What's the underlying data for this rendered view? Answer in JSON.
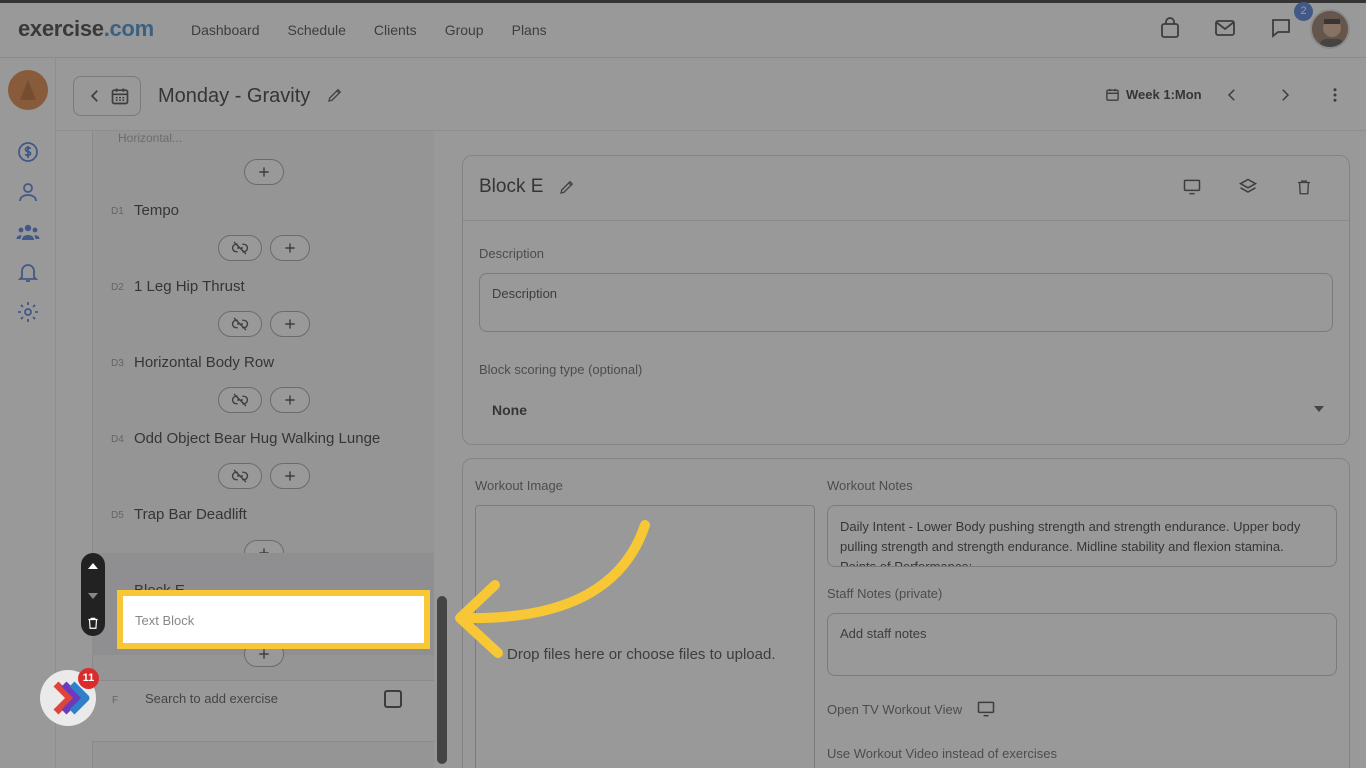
{
  "brand": {
    "name": "exercise",
    "tld": ".com"
  },
  "nav": [
    "Dashboard",
    "Schedule",
    "Clients",
    "Group",
    "Plans"
  ],
  "top_icons": {
    "bag": "shopping-bag-icon",
    "mail": "mail-icon",
    "chat": "chat-icon",
    "chat_badge": "2"
  },
  "page": {
    "title": "Monday - Gravity",
    "week_label": "Week 1:Mon"
  },
  "left_list": {
    "truncated_top": "Horizontal...",
    "exercises": [
      {
        "code": "D1",
        "name": "Tempo"
      },
      {
        "code": "D2",
        "name": "1 Leg Hip Thrust"
      },
      {
        "code": "D3",
        "name": "Horizontal Body Row"
      },
      {
        "code": "D4",
        "name": "Odd Object Bear Hug Walking Lunge"
      },
      {
        "code": "D5",
        "name": "Trap Bar Deadlift"
      }
    ],
    "block_e_label": "Block E",
    "text_block": "Text Block",
    "search_code": "F",
    "search_placeholder": "Search to add exercise"
  },
  "fab_badge": "11",
  "block_card": {
    "title": "Block E",
    "description_label": "Description",
    "description_placeholder": "Description",
    "scoring_label": "Block scoring type (optional)",
    "scoring_value": "None"
  },
  "workout": {
    "image_label": "Workout Image",
    "drop_text": "Drop files here or choose files to upload.",
    "notes_label": "Workout Notes",
    "notes_line1": "Daily Intent - Lower Body pushing strength and strength endurance. Upper body",
    "notes_line2": "pulling strength and strength endurance. Midline stability and flexion stamina.",
    "notes_line3": "Points of Performance:",
    "staff_label": "Staff Notes (private)",
    "staff_placeholder": "Add staff notes",
    "tv_label": "Open TV Workout View",
    "video_label": "Use Workout Video instead of exercises"
  },
  "colors": {
    "highlight": "#f7c736",
    "accent": "#3f6fd8",
    "overlay": "#464646"
  }
}
